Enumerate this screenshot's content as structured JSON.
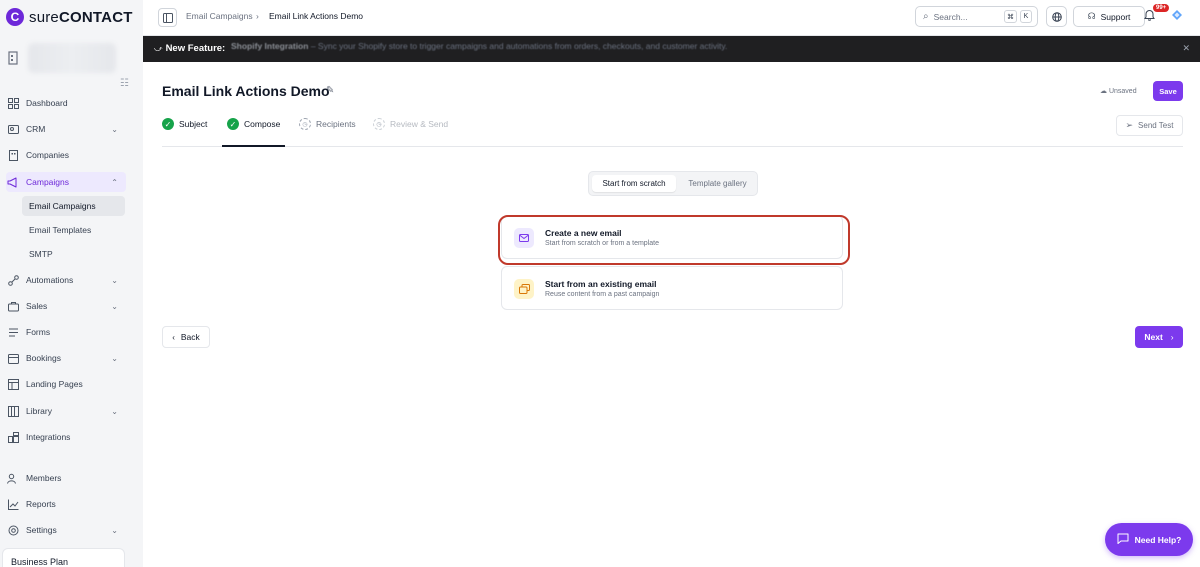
{
  "brand": {
    "logo_letter": "C",
    "name_light": "sure",
    "name_bold": "CONTACT",
    "accent": "#7c3aed"
  },
  "sidebar": {
    "items": [
      {
        "label": "Dashboard",
        "icon": "dashboard-icon"
      },
      {
        "label": "CRM",
        "icon": "crm-icon"
      },
      {
        "label": "Companies",
        "icon": "building-icon"
      },
      {
        "label": "Campaigns",
        "icon": "megaphone-icon"
      },
      {
        "label": "Automations",
        "icon": "flow-icon"
      },
      {
        "label": "Sales",
        "icon": "briefcase-icon"
      },
      {
        "label": "Forms",
        "icon": "form-icon"
      },
      {
        "label": "Bookings",
        "icon": "calendar-icon"
      },
      {
        "label": "Landing Pages",
        "icon": "layout-icon"
      },
      {
        "label": "Library",
        "icon": "library-icon"
      },
      {
        "label": "Integrations",
        "icon": "puzzle-icon"
      },
      {
        "label": "Members",
        "icon": "users-icon"
      },
      {
        "label": "Reports",
        "icon": "chart-icon"
      },
      {
        "label": "Settings",
        "icon": "gear-icon"
      }
    ],
    "campaign_sub": [
      "Email Campaigns",
      "Email Templates",
      "SMTP"
    ],
    "plan": "Business Plan"
  },
  "topbar": {
    "breadcrumb": [
      "Email Campaigns",
      "Email Link Actions Demo"
    ],
    "search_placeholder": "Search...",
    "kbd_1": "⌘",
    "kbd_2": "K",
    "support_label": "Support",
    "notification_badge": "99+"
  },
  "banner": {
    "title": "New Feature:",
    "highlight": "Shopify Integration",
    "text": "– Sync your Shopify store to trigger campaigns and automations from orders, checkouts, and customer activity."
  },
  "page": {
    "title": "Email Link Actions Demo",
    "status": "Unsaved",
    "save_label": "Save",
    "send_test_label": "Send Test",
    "steps": [
      {
        "label": "Subject",
        "state": "done"
      },
      {
        "label": "Compose",
        "state": "done"
      },
      {
        "label": "Recipients",
        "state": "pending"
      },
      {
        "label": "Review & Send",
        "state": "disabled"
      }
    ],
    "source_tabs": [
      "Start from scratch",
      "Template gallery"
    ],
    "options": [
      {
        "title": "Create a new email",
        "subtitle": "Start from scratch or from a template"
      },
      {
        "title": "Start from an existing email",
        "subtitle": "Reuse content from a past campaign"
      }
    ],
    "back_label": "Back",
    "next_label": "Next"
  },
  "help": {
    "label": "Need Help?"
  }
}
